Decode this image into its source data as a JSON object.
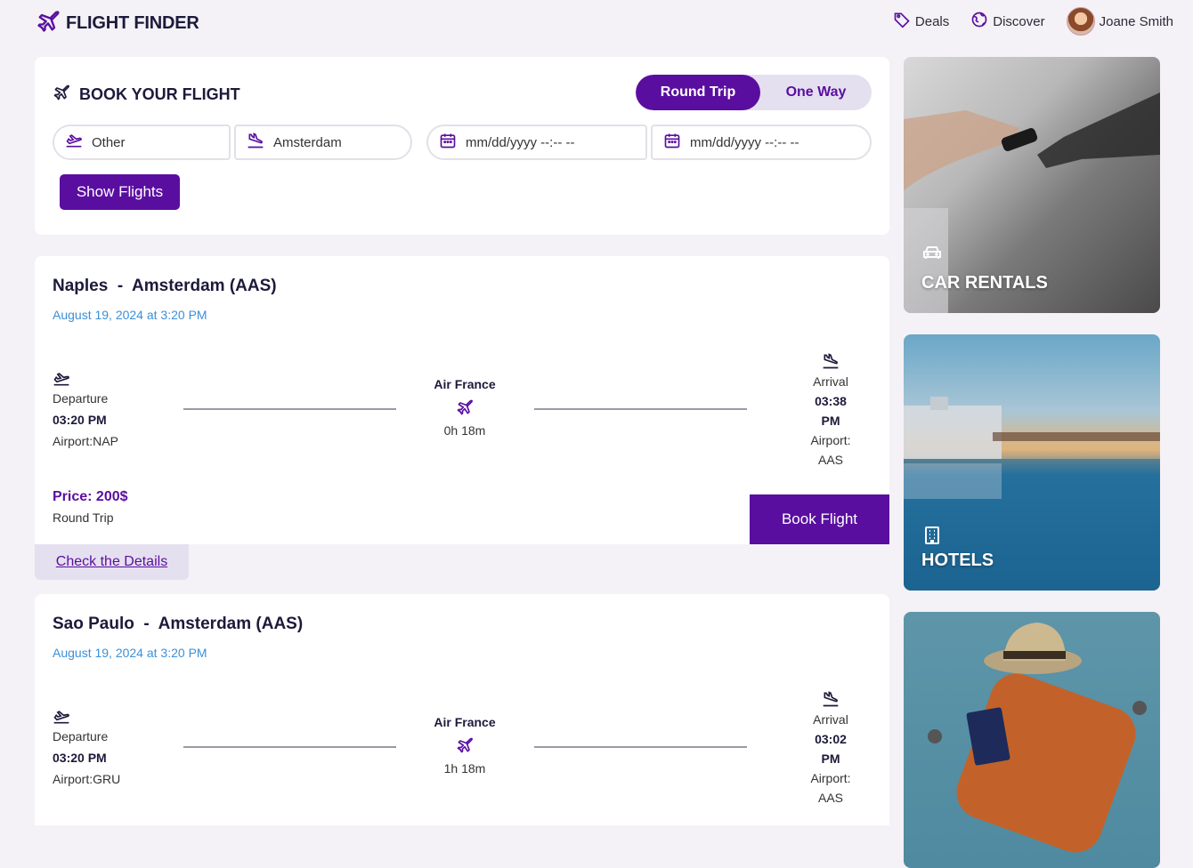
{
  "header": {
    "logo_text": "FLIGHT FINDER",
    "nav": {
      "deals": "Deals",
      "discover": "Discover",
      "user": "Joane Smith"
    }
  },
  "booking": {
    "title": "BOOK YOUR FLIGHT",
    "trip_options": {
      "round": "Round Trip",
      "one_way": "One Way",
      "selected": "Round Trip"
    },
    "from_value": "Other",
    "to_value": "Amsterdam",
    "depart_date_placeholder": "mm/dd/yyyy --:-- --",
    "return_date_placeholder": "mm/dd/yyyy --:-- --",
    "show_button": "Show Flights"
  },
  "flights": [
    {
      "route": "Naples  -  Amsterdam (AAS)",
      "date": "August 19, 2024 at 3:20 PM",
      "departure_label": "Departure",
      "departure_time": "03:20 PM",
      "departure_airport": "Airport:NAP",
      "airline": "Air France",
      "duration": "0h 18m",
      "arrival_label": "Arrival",
      "arrival_time_line1": "03:38",
      "arrival_time_line2": "PM",
      "arrival_airport_line1": "Airport:",
      "arrival_airport_line2": "AAS",
      "price": "Price: 200$",
      "trip_kind": "Round Trip",
      "book_button": "Book Flight",
      "details_link": "Check the Details"
    },
    {
      "route": "Sao Paulo  -  Amsterdam (AAS)",
      "date": "August 19, 2024 at 3:20 PM",
      "departure_label": "Departure",
      "departure_time": "03:20 PM",
      "departure_airport": "Airport:GRU",
      "airline": "Air France",
      "duration": "1h 18m",
      "arrival_label": "Arrival",
      "arrival_time_line1": "03:02",
      "arrival_time_line2": "PM",
      "arrival_airport_line1": "Airport:",
      "arrival_airport_line2": "AAS"
    }
  ],
  "promos": {
    "car_rentals": "CAR RENTALS",
    "hotels": "HOTELS"
  },
  "colors": {
    "accent": "#5a0ea0",
    "date_blue": "#3c8fd8",
    "background": "#f4f2f6"
  }
}
